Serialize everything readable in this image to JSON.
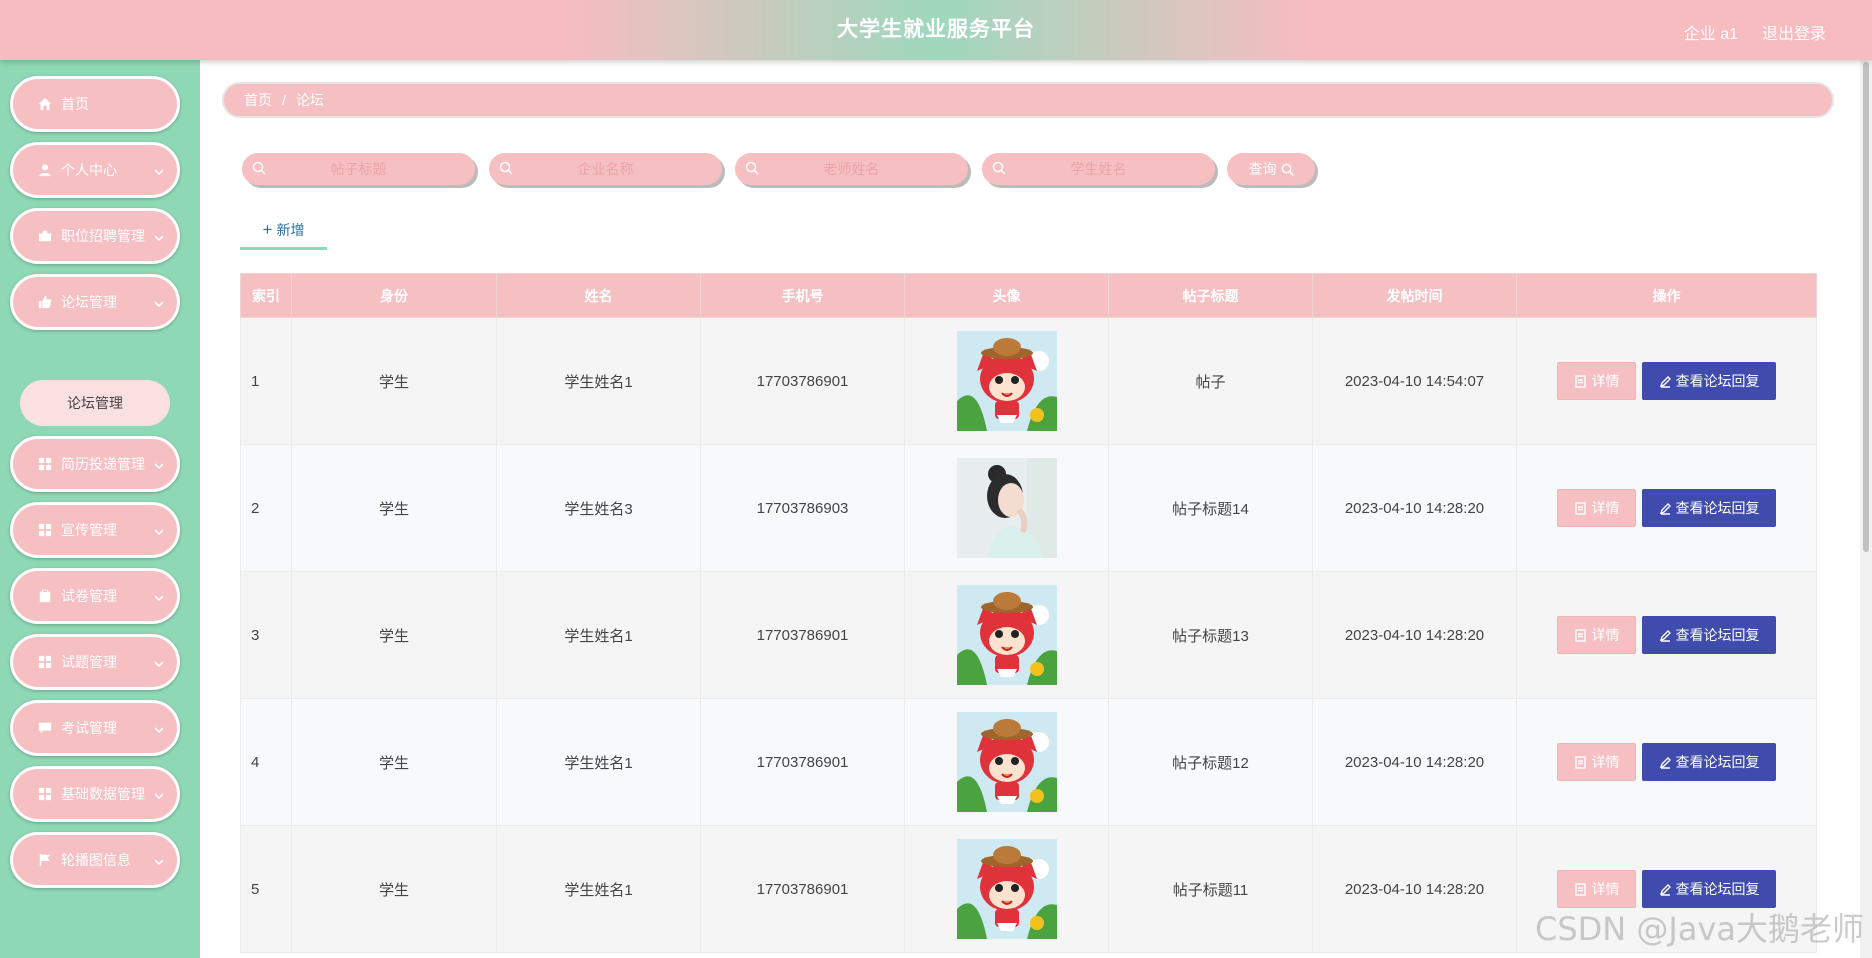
{
  "header": {
    "title": "大学生就业服务平台",
    "user": "企业 a1",
    "logout": "退出登录"
  },
  "sidebar": {
    "items": [
      {
        "label": "首页",
        "icon": "home-icon"
      },
      {
        "label": "个人中心",
        "icon": "user-icon"
      },
      {
        "label": "职位招聘管理",
        "icon": "briefcase-icon"
      },
      {
        "label": "论坛管理",
        "icon": "thumb-icon"
      },
      {
        "label": "简历投递管理",
        "icon": "grid-icon"
      },
      {
        "label": "宣传管理",
        "icon": "grid-icon"
      },
      {
        "label": "试卷管理",
        "icon": "clipboard-icon"
      },
      {
        "label": "试题管理",
        "icon": "grid-icon"
      },
      {
        "label": "考试管理",
        "icon": "chat-icon"
      },
      {
        "label": "基础数据管理",
        "icon": "grid-icon"
      },
      {
        "label": "轮播图信息",
        "icon": "flag-icon"
      }
    ],
    "submenu": {
      "label": "论坛管理"
    }
  },
  "breadcrumb": {
    "home": "首页",
    "sep": "/",
    "current": "论坛"
  },
  "search": {
    "post_title_placeholder": "帖子标题",
    "company_placeholder": "企业名称",
    "teacher_placeholder": "老师姓名",
    "student_placeholder": "学生姓名",
    "query_label": "查询"
  },
  "actions": {
    "add_label": "新增",
    "detail_label": "详情",
    "reply_label": "查看论坛回复"
  },
  "table": {
    "headers": [
      "索引",
      "身份",
      "姓名",
      "手机号",
      "头像",
      "帖子标题",
      "发帖时间",
      "操作"
    ],
    "rows": [
      {
        "index": "1",
        "role": "学生",
        "name": "学生姓名1",
        "phone": "17703786901",
        "avatar": "cartoon-fox",
        "title": "帖子",
        "time": "2023-04-10 14:54:07"
      },
      {
        "index": "2",
        "role": "学生",
        "name": "学生姓名3",
        "phone": "17703786903",
        "avatar": "woman-photo",
        "title": "帖子标题14",
        "time": "2023-04-10 14:28:20"
      },
      {
        "index": "3",
        "role": "学生",
        "name": "学生姓名1",
        "phone": "17703786901",
        "avatar": "cartoon-fox",
        "title": "帖子标题13",
        "time": "2023-04-10 14:28:20"
      },
      {
        "index": "4",
        "role": "学生",
        "name": "学生姓名1",
        "phone": "17703786901",
        "avatar": "cartoon-fox",
        "title": "帖子标题12",
        "time": "2023-04-10 14:28:20"
      },
      {
        "index": "5",
        "role": "学生",
        "name": "学生姓名1",
        "phone": "17703786901",
        "avatar": "cartoon-fox",
        "title": "帖子标题11",
        "time": "2023-04-10 14:28:20"
      }
    ]
  },
  "watermark": "CSDN @Java大鹅老师",
  "colors": {
    "accent_pink": "#f6bfc2",
    "sidebar_green": "#8ed8b5",
    "reply_blue": "#3f4bad"
  }
}
